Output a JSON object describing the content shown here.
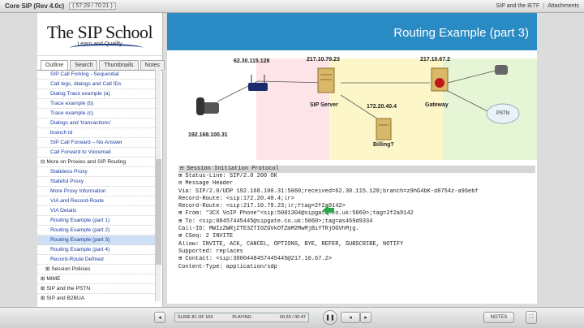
{
  "window": {
    "title": "Core SIP (Rev 4.0c)",
    "time": "57:29 / 70:21",
    "links": [
      "SIP and the IETF",
      "Attachments"
    ]
  },
  "logo": {
    "name": "The SIP School",
    "tagline": "Learn and Qualify"
  },
  "tabs": [
    "Outline",
    "Search",
    "Thumbnails",
    "Notes"
  ],
  "toc": [
    {
      "label": "SIP Call Forking - Sequential",
      "level": 2
    },
    {
      "label": "Call legs, dialogs and Call IDs",
      "level": 2
    },
    {
      "label": "Dialog Trace example (a)",
      "level": 2
    },
    {
      "label": "Trace example (b)",
      "level": 2
    },
    {
      "label": "Trace example (c)",
      "level": 2
    },
    {
      "label": "Dialogs and 'transactions'",
      "level": 2
    },
    {
      "label": "branch id",
      "level": 2
    },
    {
      "label": "SIP Call Forward – No Answer",
      "level": 2
    },
    {
      "label": "Call Forward to Voicemail",
      "level": 2
    },
    {
      "label": "More on Proxies and SIP Routing",
      "level": 1,
      "prefix": "⊟"
    },
    {
      "label": "Stateless Proxy",
      "level": 2
    },
    {
      "label": "Stateful Proxy",
      "level": 2
    },
    {
      "label": "More Proxy Information",
      "level": 2
    },
    {
      "label": "VIA and Record-Route",
      "level": 2
    },
    {
      "label": "VIA Details",
      "level": 2
    },
    {
      "label": "Routing Example (part 1)",
      "level": 2
    },
    {
      "label": "Routing Example (part 2)",
      "level": 2
    },
    {
      "label": "Routing Example (part 3)",
      "level": 2,
      "selected": true
    },
    {
      "label": "Routing Example (part 4)",
      "level": 2
    },
    {
      "label": "Record-Route Defined",
      "level": 2
    },
    {
      "label": "Session Policies",
      "level": 1,
      "prefix": "⊞",
      "indent": true
    },
    {
      "label": "MIME",
      "level": 1,
      "prefix": "⊞"
    },
    {
      "label": "SIP and the PSTN",
      "level": 1,
      "prefix": "⊞"
    },
    {
      "label": "SIP and B2BUA",
      "level": 1,
      "prefix": "⊞"
    }
  ],
  "slide": {
    "title": "Routing Example (part 3)",
    "diagram": {
      "phone_ip": "192.168.100.31",
      "router_ip": "62.30.115.128",
      "sip_server_ip": "217.10.79.23",
      "sip_server_label": "SIP Server",
      "billing_ip": "172.20.40.4",
      "billing_label": "Billing?",
      "gateway_ip": "217.10.67.2",
      "gateway_label": "Gateway",
      "pstn_label": "PSTN"
    },
    "trace": {
      "header": "⊟ Session Initiation Protocol",
      "lines": [
        " ⊞ Status-Line: SIP/2.0 200 OK",
        " ⊟ Message Header",
        "     Via: SIP/2.0/UDP 192.168.100.31:5060;received=62.30.115.128;branch=z9hG4bK-d8754z-a96ebf",
        "     Record-Route: <sip:172.20.40.4;lr>",
        "     Record-Route: <sip:217.10.79.23;lr;ftag=2f2a9142>",
        "   ⊞ From: \"3CX VoIP Phone\"<sip:5081304@sipgate.co.uk:5060>;tag=2f2a9142",
        "   ⊞ To: <sip:08457445445@sipgate.co.uk:5060>;tag=as469d9334",
        "     Call-ID: MWIzZWRjZTE3ZTI0ZGVkOTZmM2MwMjBiYTRjOGVhMjg.",
        "   ⊞ CSeq: 2 INVITE",
        "     Allow: INVITE, ACK, CANCEL, OPTIONS, BYE, REFER, SUBSCRIBE, NOTIFY",
        "     Supported: replaces",
        "   ⊞ Contact: <sip:3000448457445445@217.10.67.2>",
        "     Content-Type: application/sdp"
      ]
    }
  },
  "player": {
    "slide": "SLIDE 81 OF 103",
    "status": "PLAYING",
    "time": "00:29 / 00:47",
    "notes": "NOTES"
  },
  "colors": {
    "banner": "#2a8bc4",
    "zone_pink": "#fde4e8",
    "zone_yellow": "#fdf6c8",
    "zone_green": "#e6f5d6",
    "arrow": "#2aa84a"
  }
}
